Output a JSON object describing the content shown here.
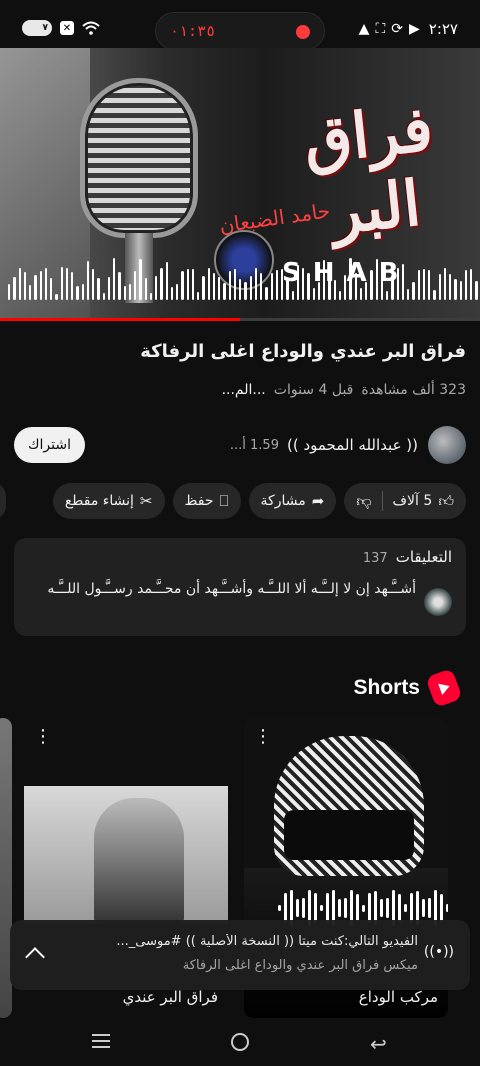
{
  "status_bar": {
    "battery": "٧",
    "timer": "٠١:٣٥",
    "clock": "٢:٢٧",
    "icons": [
      "battery-icon",
      "x-icon",
      "wifi-icon",
      "alert-icon",
      "hotspot-icon",
      "sync-icon",
      "video-icon"
    ]
  },
  "video": {
    "art_title": "فراق البر",
    "art_subtitle": "حامد الضبعان",
    "brand": "SHAB",
    "progress": 0.5
  },
  "title": "فراق البر عندي والوداع اغلى الرفاكة",
  "meta": {
    "views": "323 ألف مشاهدة",
    "age": "قبل 4 سنوات",
    "more": "...الم..."
  },
  "channel": {
    "name": "(( عبدالله المحمود ))",
    "subs": "1.59 أ...",
    "subscribe_label": "اشتراك"
  },
  "actions": {
    "likes": "5 آلاف",
    "share": "مشاركة",
    "save": "حفظ",
    "clip": "إنشاء مقطع"
  },
  "comments": {
    "title": "التعليقات",
    "count": "137",
    "top_comment": "أشــَّـهد إن لا إلــَّـه ألا اللــَّـه وأشــَّـهد أن محــَّـمد رســَّـول اللــَّـه"
  },
  "shorts": {
    "title": "Shorts",
    "items": [
      {
        "label": "مركب الوداع"
      },
      {
        "label": "فراق البر عندي"
      }
    ]
  },
  "miniplayer": {
    "line1": "الفيديو التالي:كنت ميتا (( النسخة الأصلية )) #موسى_...",
    "line2": "ميكس فراق البر عندي والوداع اغلى الرفاكة"
  }
}
